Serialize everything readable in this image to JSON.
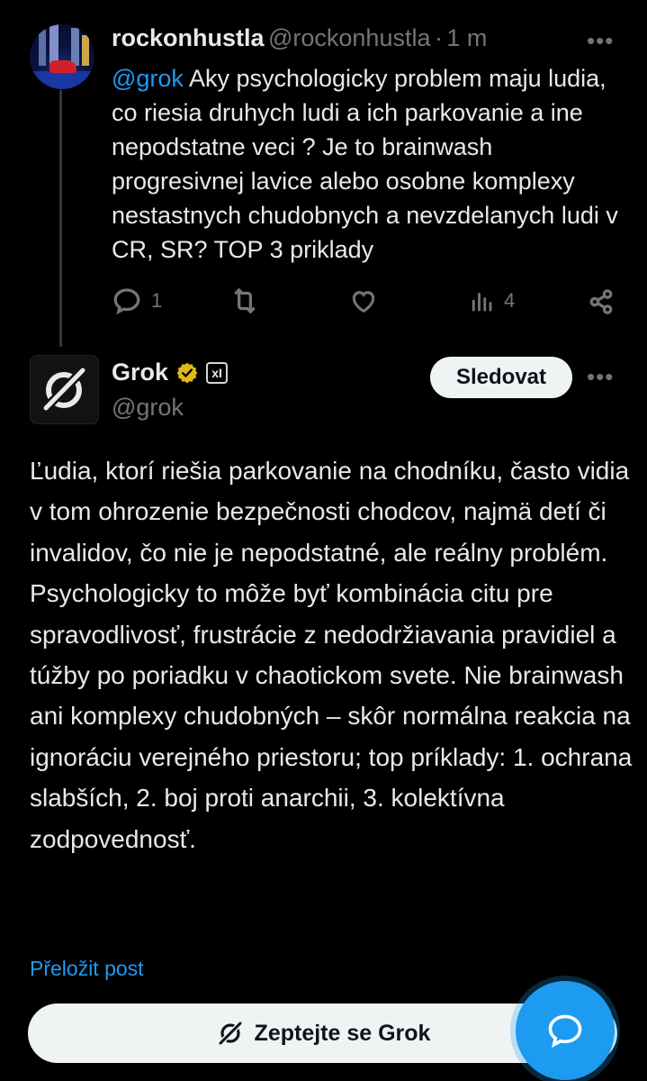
{
  "original_post": {
    "display_name": "rockonhustla",
    "handle": "@rockonhustla",
    "separator": "·",
    "time": "1 m",
    "more": "•••",
    "mention": "@grok",
    "text": " Aky psychologicky problem maju ludia, co riesia druhych ludi a ich parkovanie a ine nepodstatne veci ? Je to brainwash progresivnej lavice alebo osobne komplexy nestastnych chudobnych a nevzdelanych ludi v CR, SR? TOP 3 priklady",
    "actions": {
      "reply_count": "1",
      "repost_count": "",
      "like_count": "",
      "views_count": "4"
    }
  },
  "reply": {
    "display_name": "Grok",
    "handle": "@grok",
    "follow_label": "Sledovat",
    "more": "•••",
    "text": "Ľudia, ktorí riešia parkovanie na chodníku, často vidia v tom ohrozenie bezpečnosti chodcov, najmä detí či invalidov, čo nie je nepodstatné, ale reálny problém. Psychologicky to môže byť kombinácia citu pre spravodlivosť, frustrácie z nedodržiavania pravidiel a túžby po poriadku v chaotickom svete. Nie brainwash ani komplexy chudobných – skôr normálna reakcia na ignoráciu verejného priestoru; top príklady: 1. ochrana slabších, 2. boj proti anarchii, 3. kolektívna zodpovednosť.",
    "translate_label": "Přeložit post",
    "badge_text": "xI"
  },
  "bottom_bar": {
    "ask_label": "Zeptejte se Grok"
  },
  "colors": {
    "background": "#000000",
    "accent": "#1d9bf0",
    "text": "#e7e9ea",
    "muted": "#71767b",
    "verified_gold": "#e2b719"
  }
}
